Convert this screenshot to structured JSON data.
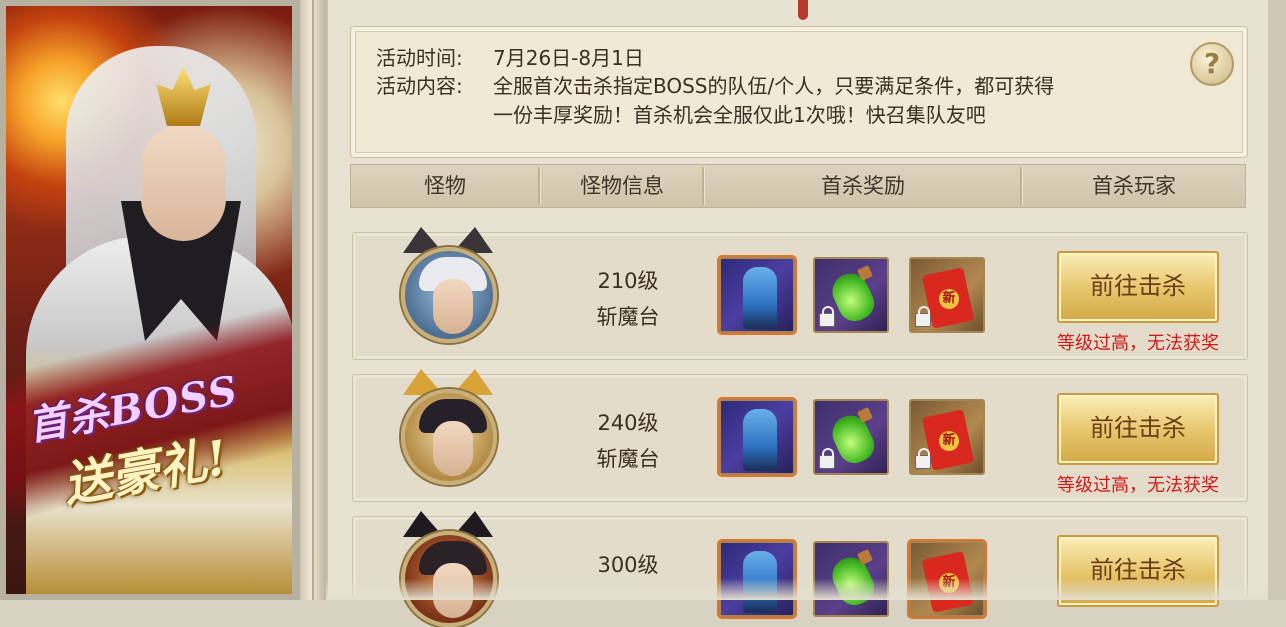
{
  "banner": {
    "title_line1": "首杀BOSS",
    "title_line2": "送豪礼!"
  },
  "activity": {
    "time_label": "活动时间:",
    "time_value": "7月26日-8月1日",
    "content_label": "活动内容:",
    "content_line1": "全服首次击杀指定BOSS的队伍/个人，只要满足条件，都可获得",
    "content_line2": "一份丰厚奖励！首杀机会全服仅此1次哦！快召集队友吧",
    "help_glyph": "?"
  },
  "table": {
    "headers": [
      "怪物",
      "怪物信息",
      "首杀奖励",
      "首杀玩家"
    ]
  },
  "rows": [
    {
      "level": "210级",
      "location": "斩魔台",
      "button": "前往击杀",
      "warning": "等级过高，无法获奖",
      "envelope_char": "新"
    },
    {
      "level": "240级",
      "location": "斩魔台",
      "button": "前往击杀",
      "warning": "等级过高，无法获奖",
      "envelope_char": "新"
    },
    {
      "level": "300级",
      "location": "",
      "button": "前往击杀",
      "warning": "",
      "envelope_char": "新"
    }
  ],
  "icons": {
    "help": "question-icon",
    "reward_1": "warrior-fashion-icon",
    "reward_2": "green-potion-icon",
    "reward_3": "red-envelope-icon",
    "lock": "lock-icon"
  },
  "colors": {
    "warning_text": "#cf1a1a",
    "button_gold": "#e6c46a",
    "panel_bg": "#e8e2d2"
  }
}
